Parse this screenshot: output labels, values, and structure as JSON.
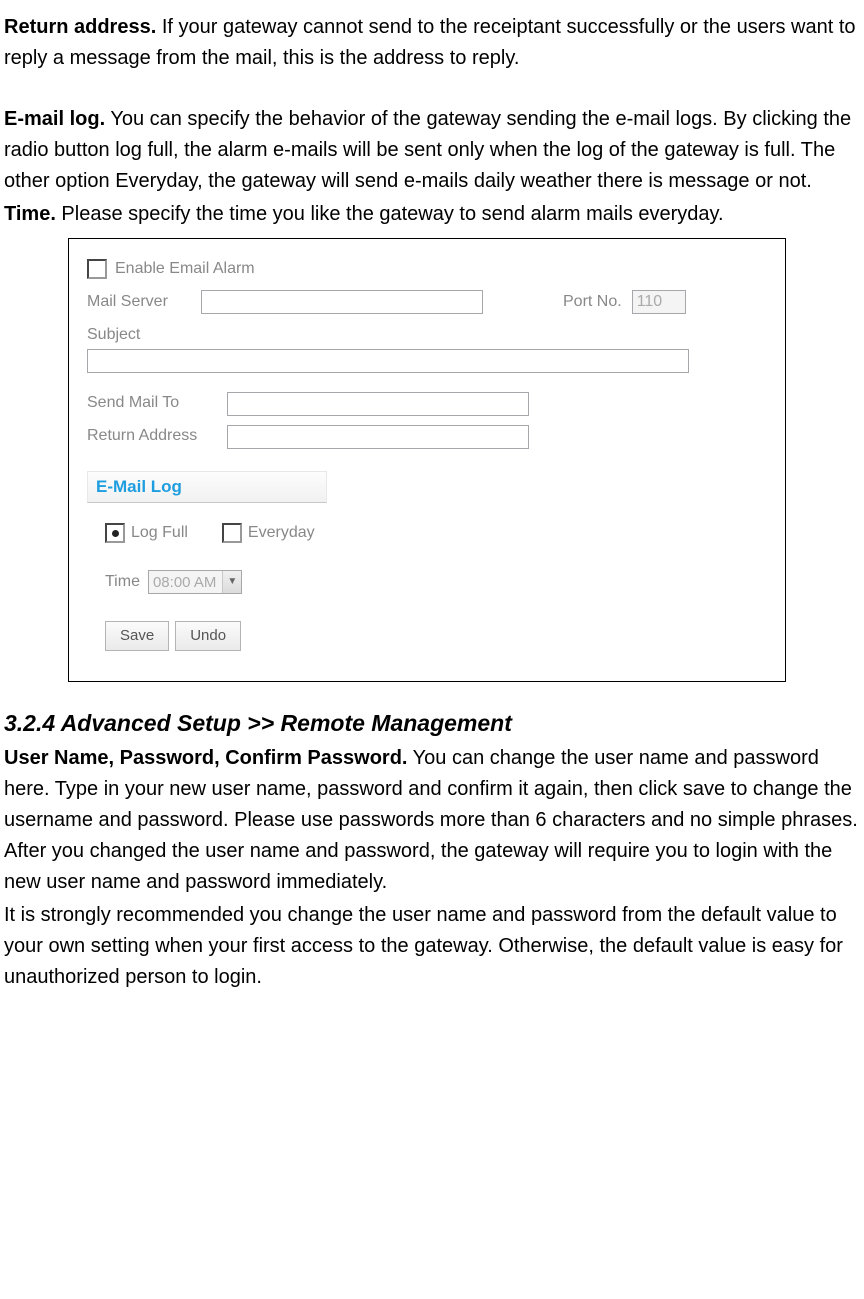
{
  "intro": {
    "return_label": "Return address.",
    "return_text": " If your gateway cannot send to the receiptant successfully or the users want to reply a message from the mail, this is the address to reply.",
    "email_label": "E-mail log.",
    "email_text": " You can specify the behavior of the gateway sending the e-mail logs. By clicking the radio button log full, the alarm e-mails will be sent only when the log of the gateway is full. The other option Everyday, the gateway will send e-mails daily weather there is message or not.",
    "time_label": "Time.",
    "time_text": " Please specify the time you like the gateway to send alarm mails everyday."
  },
  "form": {
    "enable_label": "Enable Email Alarm",
    "mail_server_label": "Mail Server",
    "port_label": "Port No.",
    "port_value": "110",
    "subject_label": "Subject",
    "send_to_label": "Send Mail To",
    "return_addr_label": "Return Address",
    "section_title": "E-Mail Log",
    "radio_logfull": "Log Full",
    "radio_everyday": "Everyday",
    "time_label": "Time",
    "time_value": "08:00 AM",
    "save_btn": "Save",
    "undo_btn": "Undo"
  },
  "section2": {
    "heading": "3.2.4 Advanced Setup >> Remote Management",
    "para_label": "User Name, Password, Confirm Password.",
    "para_text": " You can change the user name and password here. Type in your new user name, password and confirm it again, then click save to change the username and password. Please use passwords more than 6 characters and no simple phrases. After you changed the user name and password, the gateway will require you to login with the new user name and password immediately.",
    "para2": "It is strongly recommended you change the user name and password from the default value to your own setting when your first access to the gateway. Otherwise, the default value is easy for unauthorized person to login."
  }
}
